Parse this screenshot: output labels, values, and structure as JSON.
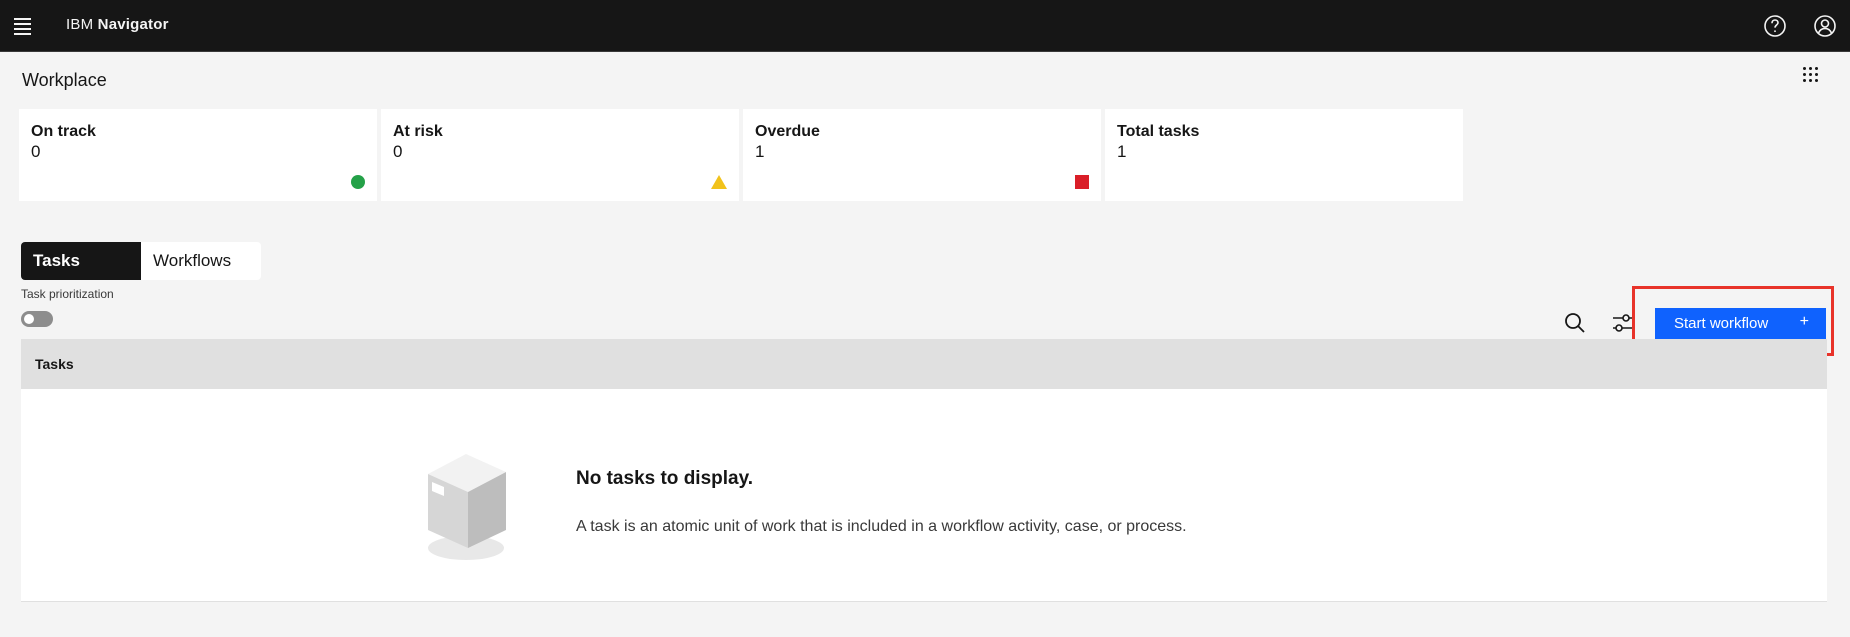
{
  "header": {
    "brand_prefix": "IBM",
    "brand_name": "Navigator",
    "icons": [
      "menu-icon",
      "help-icon",
      "user-avatar-icon"
    ]
  },
  "page": {
    "title": "Workplace",
    "layout_icon": "app-grid-icon"
  },
  "summary_cards": [
    {
      "label": "On track",
      "value": "0",
      "indicator": "green-circle",
      "color": "#24a148"
    },
    {
      "label": "At risk",
      "value": "0",
      "indicator": "yellow-triangle",
      "color": "#f1c21b"
    },
    {
      "label": "Overdue",
      "value": "1",
      "indicator": "red-square",
      "color": "#da1e28"
    },
    {
      "label": "Total tasks",
      "value": "1",
      "indicator": "none",
      "color": ""
    }
  ],
  "tabs": [
    {
      "label": "Tasks",
      "active": true
    },
    {
      "label": "Workflows",
      "active": false
    }
  ],
  "task_prioritization": {
    "label": "Task prioritization",
    "enabled": false
  },
  "toolbar": {
    "search_icon": "search-icon",
    "filter_icon": "filter-settings-icon",
    "start_workflow_label": "Start workflow",
    "start_workflow_icon": "+",
    "accent": "#0f62fe"
  },
  "table": {
    "header": "Tasks",
    "empty_title": "No tasks to display.",
    "empty_description": "A task is an atomic unit of work that is included in a workflow activity, case, or process."
  }
}
